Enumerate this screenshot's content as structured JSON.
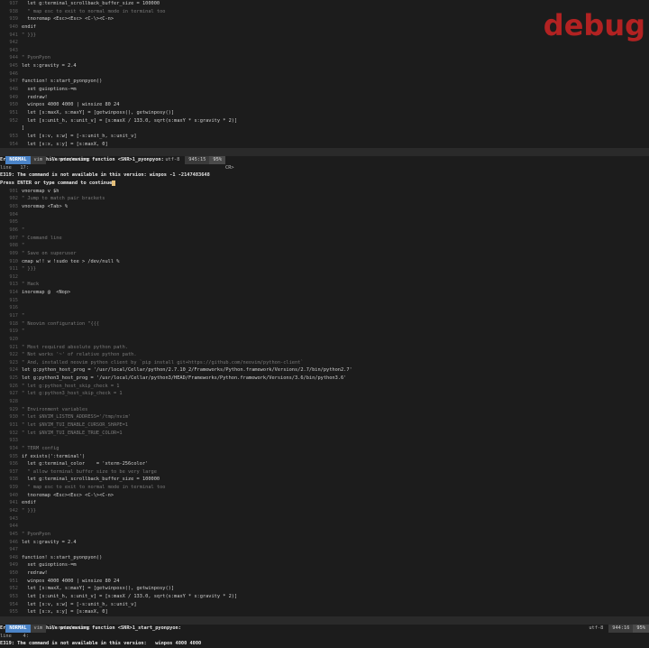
{
  "watermark": "debug",
  "top_pane": [
    {
      "ln": "937",
      "text": "  let g:terminal_scrollback_buffer_size = 100000"
    },
    {
      "ln": "938",
      "text": "  \" map esc to exit to normal mode in terminal too"
    },
    {
      "ln": "939",
      "text": "  tnoremap <Esc><Esc> <C-\\><C-n>"
    },
    {
      "ln": "940",
      "text": "endif"
    },
    {
      "ln": "941",
      "text": "\" }}}"
    },
    {
      "ln": "942",
      "text": ""
    },
    {
      "ln": "943",
      "text": ""
    },
    {
      "ln": "944",
      "text": "\" PyonPyon"
    },
    {
      "ln": "945",
      "text": "let s:gravity = 2.4"
    },
    {
      "ln": "946",
      "text": ""
    },
    {
      "ln": "947",
      "text": "function! s:start_pyonpyon()"
    },
    {
      "ln": "948",
      "text": "  set guioptions-=m"
    },
    {
      "ln": "949",
      "text": "  redraw!"
    },
    {
      "ln": "950",
      "text": "  winpos 4000 4000 | winsize 80 24"
    },
    {
      "ln": "951",
      "text": "  let [s:maxX, s:maxY] = [getwinposx(), getwinposy()]"
    },
    {
      "ln": "952",
      "text": "  let [s:unit_h, s:unit_v] = [s:maxX / 133.0, sqrt(s:maxY * s:gravity * 2)]"
    },
    {
      "ln": "  ",
      "text": "]"
    },
    {
      "ln": "953",
      "text": "  let [s:v, s:w] = [-s:unit_h, s:unit_v]"
    },
    {
      "ln": "954",
      "text": "  let [s:x, s:y] = [s:maxX, 0]"
    }
  ],
  "top_status": {
    "mode": "NORMAL",
    "filetype": "vim",
    "file": "~/.nvim/nvimrc",
    "encoding": "utf-8",
    "position": "945:15",
    "percent": "95%"
  },
  "top_messages": {
    "line1": "Error detected while processing function <SNR>1_pyonpyon:",
    "line2": "line   17:",
    "cr": "CR>",
    "line3": "E319: The command is not available in this version: winpos -1 -2147483648",
    "line4": "Press ENTER or type command to continue"
  },
  "bottom_pane": [
    {
      "ln": "901",
      "text": "vnoremap v $h"
    },
    {
      "ln": "902",
      "text": "\" Jump to match pair brackets"
    },
    {
      "ln": "903",
      "text": "vnoremap <Tab> %"
    },
    {
      "ln": "904",
      "text": ""
    },
    {
      "ln": "905",
      "text": ""
    },
    {
      "ln": "906",
      "text": "\""
    },
    {
      "ln": "907",
      "text": "\" Command line"
    },
    {
      "ln": "908",
      "text": "\""
    },
    {
      "ln": "909",
      "text": "\" Save on superuser"
    },
    {
      "ln": "910",
      "text": "cmap w!! w !sudo tee > /dev/null %"
    },
    {
      "ln": "911",
      "text": "\" }}}"
    },
    {
      "ln": "912",
      "text": ""
    },
    {
      "ln": "913",
      "text": "\" Hack"
    },
    {
      "ln": "914",
      "text": "inoremap @  <Nop>"
    },
    {
      "ln": "915",
      "text": ""
    },
    {
      "ln": "916",
      "text": ""
    },
    {
      "ln": "917",
      "text": "\""
    },
    {
      "ln": "918",
      "text": "\" Neovim configuration \"{{{"
    },
    {
      "ln": "919",
      "text": "\""
    },
    {
      "ln": "920",
      "text": ""
    },
    {
      "ln": "921",
      "text": "\" Most required absolute python path."
    },
    {
      "ln": "922",
      "text": "\" Not works '~' of relative python path."
    },
    {
      "ln": "923",
      "text": "\" And, installed neovim python client by `pip install git+https://github.com/neovim/python-client`"
    },
    {
      "ln": "924",
      "text": "let g:python_host_prog = '/usr/local/Cellar/python/2.7.10_2/Frameworks/Python.framework/Versions/2.7/bin/python2.7'"
    },
    {
      "ln": "925",
      "text": "let g:python3_host_prog = '/usr/local/Cellar/python3/HEAD/Frameworks/Python.framework/Versions/3.6/bin/python3.6'"
    },
    {
      "ln": "926",
      "text": "\" let g:python_host_skip_check = 1"
    },
    {
      "ln": "927",
      "text": "\" let g:python3_host_skip_check = 1"
    },
    {
      "ln": "928",
      "text": ""
    },
    {
      "ln": "929",
      "text": "\" Environment variables"
    },
    {
      "ln": "930",
      "text": "\" let $NVIM_LISTEN_ADDRESS='/tmp/nvim'"
    },
    {
      "ln": "931",
      "text": "\" let $NVIM_TUI_ENABLE_CURSOR_SHAPE=1"
    },
    {
      "ln": "932",
      "text": "\" let $NVIM_TUI_ENABLE_TRUE_COLOR=1"
    },
    {
      "ln": "933",
      "text": ""
    },
    {
      "ln": "934",
      "text": "\" TERM config"
    },
    {
      "ln": "935",
      "text": "if exists(':terminal')"
    },
    {
      "ln": "936",
      "text": "  let g:terminal_color    = 'xterm-256color'"
    },
    {
      "ln": "937",
      "text": "  \" allow terminal buffer size to be very large"
    },
    {
      "ln": "938",
      "text": "  let g:terminal_scrollback_buffer_size = 100000"
    },
    {
      "ln": "939",
      "text": "  \" map esc to exit to normal mode in terminal too"
    },
    {
      "ln": "940",
      "text": "  tnoremap <Esc><Esc> <C-\\><C-n>"
    },
    {
      "ln": "941",
      "text": "endif"
    },
    {
      "ln": "942",
      "text": "\" }}}"
    },
    {
      "ln": "943",
      "text": ""
    },
    {
      "ln": "944",
      "text": ""
    },
    {
      "ln": "945",
      "text": "\" PyonPyon"
    },
    {
      "ln": "946",
      "text": "let s:gravity = 2.4"
    },
    {
      "ln": "947",
      "text": ""
    },
    {
      "ln": "948",
      "text": "function! s:start_pyonpyon()"
    },
    {
      "ln": "949",
      "text": "  set guioptions-=m"
    },
    {
      "ln": "950",
      "text": "  redraw!"
    },
    {
      "ln": "951",
      "text": "  winpos 4000 4000 | winsize 80 24"
    },
    {
      "ln": "952",
      "text": "  let [s:maxX, s:maxY] = [getwinposx(), getwinposy()]"
    },
    {
      "ln": "953",
      "text": "  let [s:unit_h, s:unit_v] = [s:maxX / 133.0, sqrt(s:maxY * s:gravity * 2)]"
    },
    {
      "ln": "954",
      "text": "  let [s:v, s:w] = [-s:unit_h, s:unit_v]"
    },
    {
      "ln": "955",
      "text": "  let [s:x, s:y] = [s:maxX, 0]"
    }
  ],
  "bottom_status": {
    "mode": "NORMAL",
    "filetype": "vim",
    "file": "~/.nvim/nvimrc",
    "encoding": "utf-8",
    "position": "944:16",
    "percent": "95%"
  },
  "bottom_messages": {
    "line1": "Error detected while processing function <SNR>1_start_pyonpyon:",
    "line2": "line    4:",
    "line3": "E319: The command is not available in this version:   winpos 4000 4000"
  }
}
